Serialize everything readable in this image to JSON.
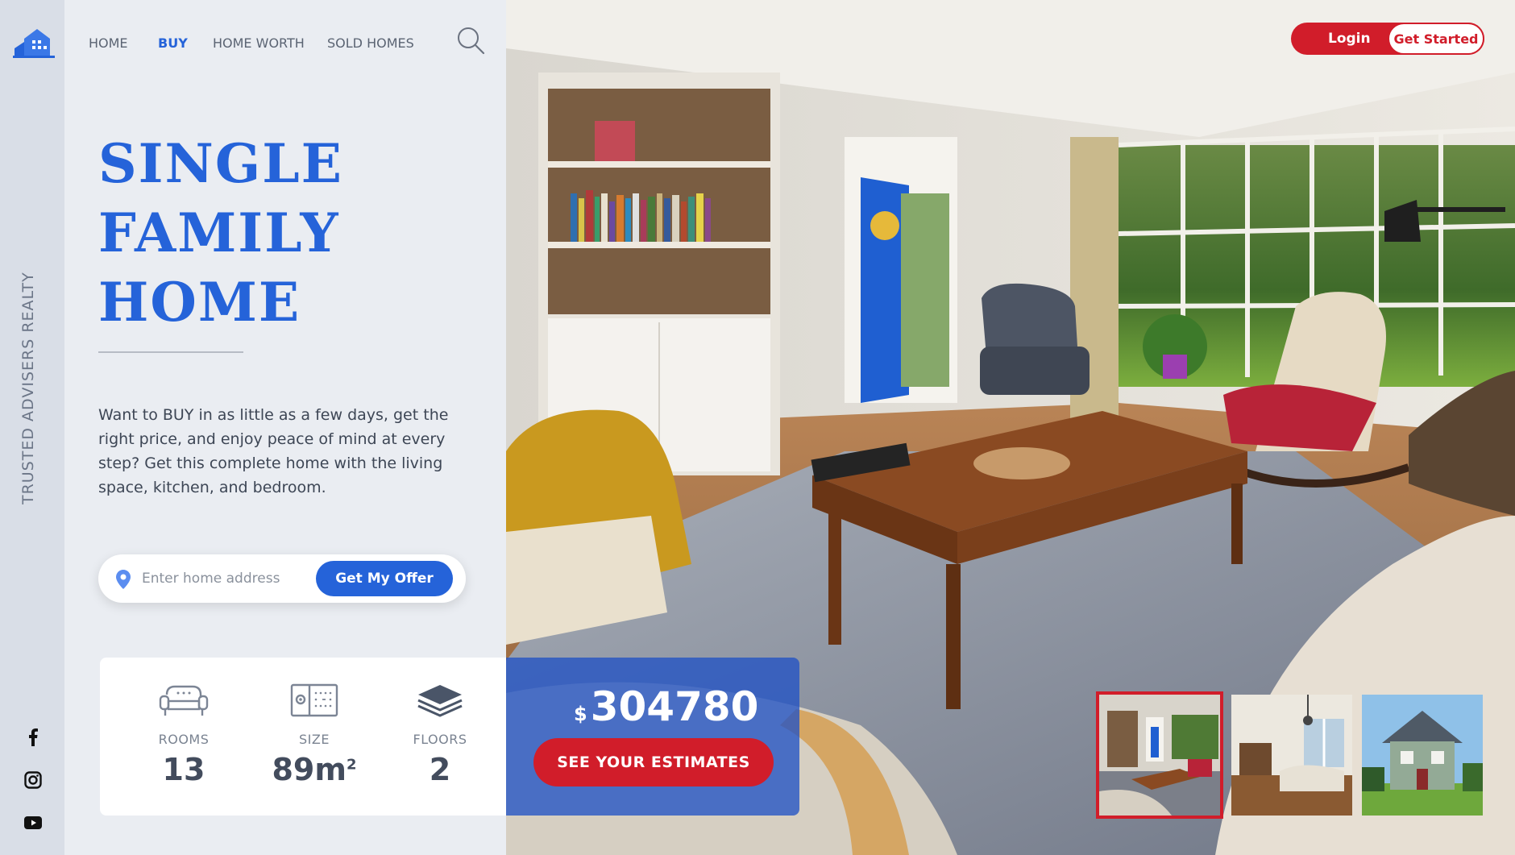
{
  "brand": {
    "tagline": "TRUSTED ADVISERS REALTY",
    "logo": "house-logo-icon"
  },
  "nav": [
    {
      "label": "HOME",
      "active": false
    },
    {
      "label": "BUY",
      "active": true
    },
    {
      "label": "HOME WORTH",
      "active": false
    },
    {
      "label": "SOLD HOMES",
      "active": false
    }
  ],
  "auth": {
    "login": "Login",
    "get_started": "Get Started"
  },
  "hero": {
    "title_lines": [
      "SINGLE",
      "FAMILY",
      "HOME"
    ],
    "description": "Want to BUY in as little as a few days, get the right price, and enjoy peace of mind at every step? Get this complete home with the living space, kitchen, and bedroom."
  },
  "address_search": {
    "placeholder": "Enter home address",
    "value": "",
    "button": "Get My Offer"
  },
  "stats": [
    {
      "icon": "sofa-icon",
      "label": "ROOMS",
      "value": "13"
    },
    {
      "icon": "floorplan-icon",
      "label": "SIZE",
      "value": "89m",
      "sup": "2"
    },
    {
      "icon": "layers-icon",
      "label": "FLOORS",
      "value": "2"
    }
  ],
  "price": {
    "currency": "$",
    "amount": "304780",
    "cta": "SEE YOUR ESTIMATES"
  },
  "thumbnails": [
    {
      "name": "living-room",
      "active": true
    },
    {
      "name": "dining-room",
      "active": false
    },
    {
      "name": "house-exterior",
      "active": false
    }
  ],
  "social": [
    "facebook-icon",
    "instagram-icon",
    "youtube-icon"
  ],
  "colors": {
    "accent": "#2563d9",
    "cta": "#d11d2a",
    "panel": "#eaedf2",
    "rail": "#d9dee7"
  }
}
